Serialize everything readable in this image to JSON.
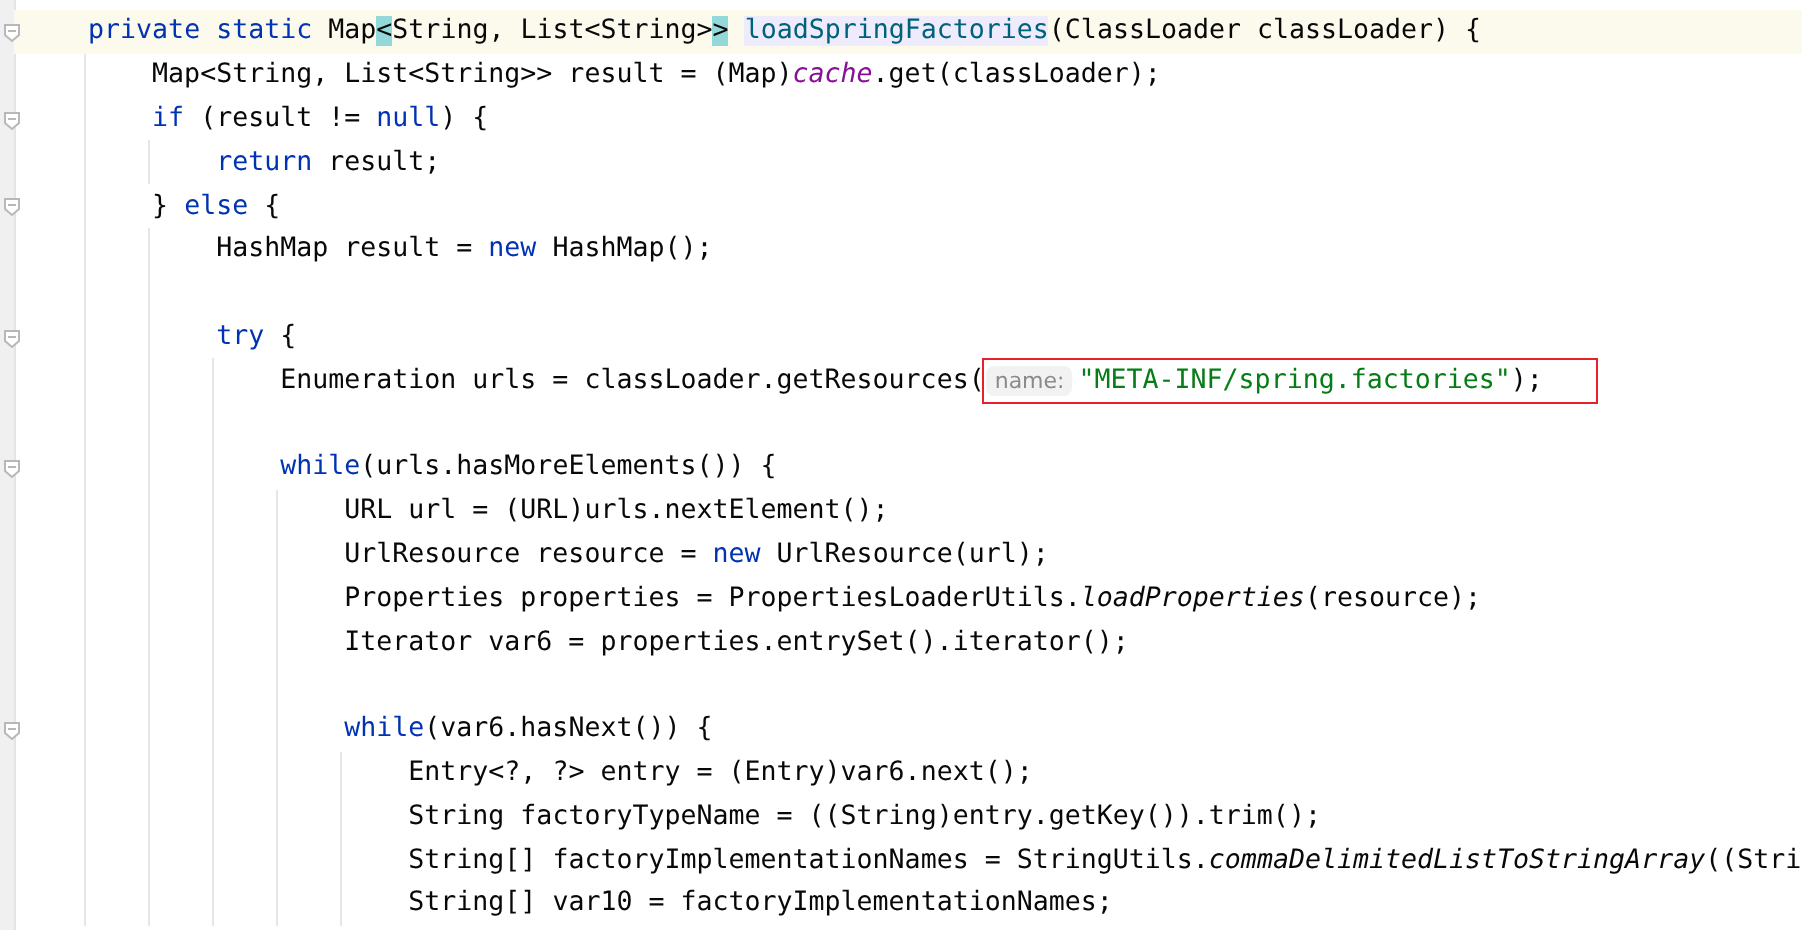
{
  "editor": {
    "lines": [
      {
        "kind": "code",
        "fold": true,
        "current": true,
        "tokens": [
          {
            "text": "    private static ",
            "kind": "keyword"
          },
          {
            "text": "Map",
            "kind": "plain"
          },
          {
            "text": "<",
            "kind": "brace-match"
          },
          {
            "text": "String, List<String>",
            "kind": "plain"
          },
          {
            "text": ">",
            "kind": "brace-match"
          },
          {
            "text": " loadSpringFactories",
            "kind": "declaration"
          },
          {
            "text": "(ClassLoader classLoader) {",
            "kind": "plain"
          }
        ]
      },
      {
        "kind": "code",
        "fold": false,
        "current": false,
        "tokens": [
          {
            "text": "        Map<String, List<String>> result = (Map)",
            "kind": "plain"
          },
          {
            "text": "cache",
            "kind": "static-field"
          },
          {
            "text": ".get(classLoader);",
            "kind": "plain"
          }
        ]
      },
      {
        "kind": "code",
        "fold": true,
        "current": false,
        "tokens": [
          {
            "text": "        if",
            "kind": "keyword"
          },
          {
            "text": " (result != ",
            "kind": "plain"
          },
          {
            "text": "null",
            "kind": "keyword"
          },
          {
            "text": ") {",
            "kind": "plain"
          }
        ]
      },
      {
        "kind": "code",
        "fold": false,
        "current": false,
        "tokens": [
          {
            "text": "            return",
            "kind": "keyword"
          },
          {
            "text": " result;",
            "kind": "plain"
          }
        ]
      },
      {
        "kind": "code",
        "fold": true,
        "current": false,
        "tokens": [
          {
            "text": "        } ",
            "kind": "plain"
          },
          {
            "text": "else",
            "kind": "keyword"
          },
          {
            "text": " {",
            "kind": "plain"
          }
        ]
      },
      {
        "kind": "code",
        "fold": false,
        "current": false,
        "tokens": [
          {
            "text": "            HashMap result = ",
            "kind": "plain"
          },
          {
            "text": "new",
            "kind": "keyword"
          },
          {
            "text": " HashMap();",
            "kind": "plain"
          }
        ]
      },
      {
        "kind": "blank"
      },
      {
        "kind": "code",
        "fold": true,
        "current": false,
        "tokens": [
          {
            "text": "            try",
            "kind": "keyword"
          },
          {
            "text": " {",
            "kind": "plain"
          }
        ]
      },
      {
        "kind": "code",
        "fold": false,
        "current": false,
        "tokens": [
          {
            "text": "                Enumeration urls = classLoader.getResources(",
            "kind": "plain"
          },
          {
            "text": "name:",
            "kind": "hint",
            "boxed": true
          },
          {
            "text": "\"META-INF/spring.factories\"",
            "kind": "string",
            "boxed": true
          },
          {
            "text": ");",
            "kind": "plain",
            "boxed": true
          }
        ]
      },
      {
        "kind": "blank"
      },
      {
        "kind": "code",
        "fold": true,
        "current": false,
        "tokens": [
          {
            "text": "                while",
            "kind": "keyword"
          },
          {
            "text": "(urls.hasMoreElements()) {",
            "kind": "plain"
          }
        ]
      },
      {
        "kind": "code",
        "fold": false,
        "current": false,
        "tokens": [
          {
            "text": "                    URL url = (URL)urls.nextElement();",
            "kind": "plain"
          }
        ]
      },
      {
        "kind": "code",
        "fold": false,
        "current": false,
        "tokens": [
          {
            "text": "                    UrlResource resource = ",
            "kind": "plain"
          },
          {
            "text": "new",
            "kind": "keyword"
          },
          {
            "text": " UrlResource(url);",
            "kind": "plain"
          }
        ]
      },
      {
        "kind": "code",
        "fold": false,
        "current": false,
        "tokens": [
          {
            "text": "                    Properties properties = PropertiesLoaderUtils.",
            "kind": "plain"
          },
          {
            "text": "loadProperties",
            "kind": "static-call"
          },
          {
            "text": "(resource);",
            "kind": "plain"
          }
        ]
      },
      {
        "kind": "code",
        "fold": false,
        "current": false,
        "tokens": [
          {
            "text": "                    Iterator var6 = properties.entrySet().iterator();",
            "kind": "plain"
          }
        ]
      },
      {
        "kind": "blank"
      },
      {
        "kind": "code",
        "fold": true,
        "current": false,
        "tokens": [
          {
            "text": "                    while",
            "kind": "keyword"
          },
          {
            "text": "(var6.hasNext()) {",
            "kind": "plain"
          }
        ]
      },
      {
        "kind": "code",
        "fold": false,
        "current": false,
        "tokens": [
          {
            "text": "                        Entry<?, ?> entry = (Entry)var6.next();",
            "kind": "plain"
          }
        ]
      },
      {
        "kind": "code",
        "fold": false,
        "current": false,
        "tokens": [
          {
            "text": "                        String factoryTypeName = ((String)entry.getKey()).trim();",
            "kind": "plain"
          }
        ]
      },
      {
        "kind": "code",
        "fold": false,
        "current": false,
        "tokens": [
          {
            "text": "                        String[] factoryImplementationNames = StringUtils.",
            "kind": "plain"
          },
          {
            "text": "commaDelimitedListToStringArray",
            "kind": "static-call"
          },
          {
            "text": "((Stri",
            "kind": "plain"
          }
        ]
      },
      {
        "kind": "code",
        "fold": false,
        "current": false,
        "tokens": [
          {
            "text": "                        String[] var10 = factoryImplementationNames;",
            "kind": "plain"
          }
        ]
      }
    ]
  }
}
